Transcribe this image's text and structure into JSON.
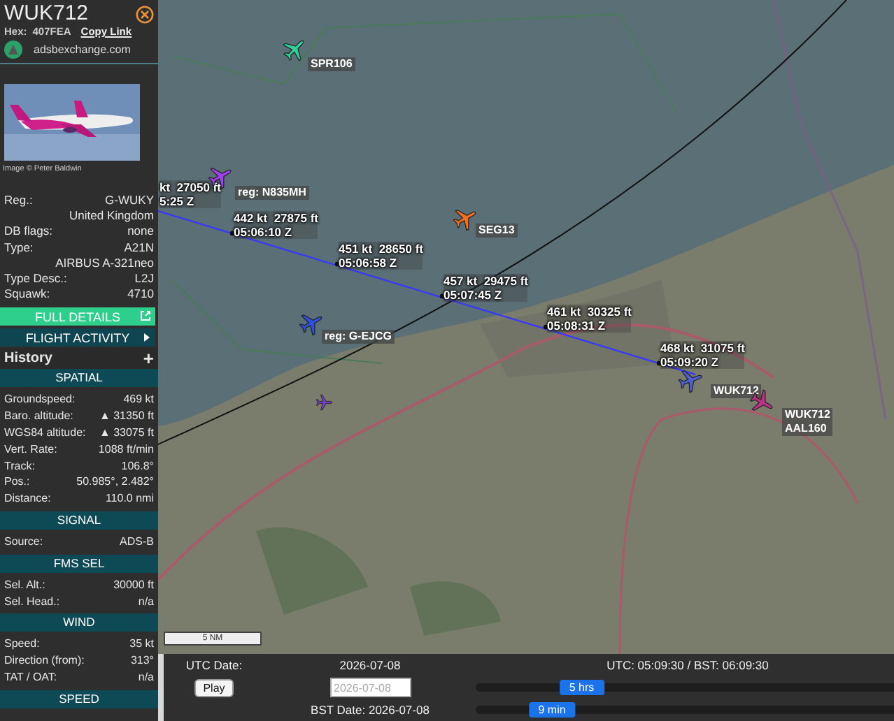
{
  "sidebar": {
    "callsign": "WUK712",
    "hex_label": "Hex:",
    "hex": "407FEA",
    "copy_link": "Copy Link",
    "site": "adsbexchange.com",
    "photo": {
      "kind": "picture",
      "credit": "Image © Peter Baldwin"
    },
    "details": [
      {
        "label": "Reg.:",
        "value": "G-WUKY"
      },
      {
        "value": "United Kingdom"
      },
      {
        "label": "DB flags:",
        "value": "none"
      },
      {
        "label": "Type:",
        "value": "A21N"
      },
      {
        "value": "AIRBUS A-321neo"
      },
      {
        "label": "Type Desc.:",
        "value": "L2J"
      },
      {
        "label": "Squawk:",
        "value": "4710"
      }
    ],
    "buttons": [
      {
        "label": "FULL DETAILS",
        "kind": "external"
      },
      {
        "label": "FLIGHT ACTIVITY",
        "kind": "arrow"
      }
    ],
    "history": {
      "title": "History",
      "toggle": "+"
    },
    "sections": [
      {
        "title": "SPATIAL",
        "rows": [
          {
            "label": "Groundspeed:",
            "value": "469 kt"
          },
          {
            "label": "Baro. altitude:",
            "value": "▲ 31350 ft"
          },
          {
            "label": "WGS84 altitude:",
            "value": "▲ 33075 ft"
          },
          {
            "label": "Vert. Rate:",
            "value": "1088 ft/min"
          },
          {
            "label": "Track:",
            "value": "106.8°"
          },
          {
            "label": "Pos.:",
            "value": "50.985°, 2.482°"
          },
          {
            "label": "Distance:",
            "value": "110.0 nmi"
          }
        ]
      },
      {
        "title": "SIGNAL",
        "rows": [
          {
            "label": "Source:",
            "value": "ADS-B"
          }
        ]
      },
      {
        "title": "FMS SEL",
        "rows": [
          {
            "label": "Sel. Alt.:",
            "value": "30000 ft"
          },
          {
            "label": "Sel. Head.:",
            "value": "n/a"
          }
        ]
      },
      {
        "title": "WIND",
        "rows": [
          {
            "label": "Speed:",
            "value": "35 kt"
          },
          {
            "label": "Direction (from):",
            "value": "313°"
          },
          {
            "label": "TAT / OAT:",
            "value": "n/a"
          }
        ]
      },
      {
        "title": "SPEED"
      }
    ]
  },
  "map": {
    "kind": "picture",
    "scale": "5 NM",
    "aircraft": [
      {
        "labels": [
          "SPR106"
        ],
        "color": "#2fd39a"
      },
      {
        "labels": [
          "reg: N835MH"
        ],
        "color": "#a040f0"
      },
      {
        "labels": [
          "SEG13"
        ],
        "color": "#f07020"
      },
      {
        "labels": [
          "reg: G-EJCG"
        ],
        "color": "#3050e0"
      },
      {
        "labels": [
          "WUK712"
        ],
        "color": "#5060d0"
      },
      {
        "labels": [
          "WUK712",
          "AAL160"
        ],
        "color": "#c0308a"
      },
      {
        "color": "#7040c0"
      }
    ],
    "track_points": [
      {
        "speed": "kt",
        "altitude": "27050 ft",
        "time": "5:25 Z"
      },
      {
        "speed": "442 kt",
        "altitude": "27875 ft",
        "time": "05:06:10 Z"
      },
      {
        "speed": "451 kt",
        "altitude": "28650 ft",
        "time": "05:06:58 Z"
      },
      {
        "speed": "457 kt",
        "altitude": "29475 ft",
        "time": "05:07:45 Z"
      },
      {
        "speed": "461 kt",
        "altitude": "30325 ft",
        "time": "05:08:31 Z"
      },
      {
        "speed": "468 kt",
        "altitude": "31075 ft",
        "time": "05:09:20 Z"
      }
    ]
  },
  "timebar": {
    "utc_date_label": "UTC Date:",
    "utc_date": "2026-07-08",
    "clock": "UTC: 05:09:30 / BST: 06:09:30",
    "play": "Play",
    "date_field": {
      "placeholder": "2026-07-08"
    },
    "bst_date": "BST Date: 2026-07-08",
    "sliders": [
      {
        "label": "5 hrs",
        "level": 0.25
      },
      {
        "label": "9 min",
        "level": 0.18
      }
    ]
  }
}
